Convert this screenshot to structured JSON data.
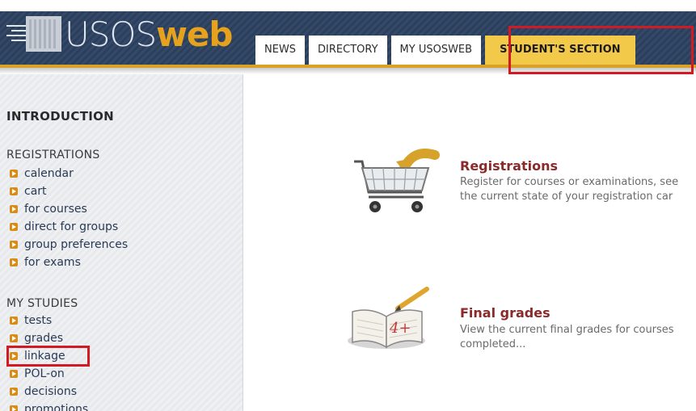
{
  "logo": {
    "part1": "USOS",
    "part2": "web"
  },
  "tabs": [
    {
      "label": "NEWS"
    },
    {
      "label": "DIRECTORY"
    },
    {
      "label": "MY USOSWEB"
    },
    {
      "label": "STUDENT'S SECTION"
    }
  ],
  "sidebar": {
    "intro": "INTRODUCTION",
    "registrations": {
      "heading": "REGISTRATIONS",
      "items": [
        {
          "label": "calendar"
        },
        {
          "label": "cart"
        },
        {
          "label": "for courses"
        },
        {
          "label": "direct for groups"
        },
        {
          "label": "group preferences"
        },
        {
          "label": "for exams"
        }
      ]
    },
    "studies": {
      "heading": "MY STUDIES",
      "items": [
        {
          "label": "tests"
        },
        {
          "label": "grades"
        },
        {
          "label": "linkage"
        },
        {
          "label": "POL-on"
        },
        {
          "label": "decisions"
        },
        {
          "label": "promotions"
        }
      ]
    }
  },
  "main": {
    "registrations": {
      "title": "Registrations",
      "desc_line1": "Register for courses or examinations, see",
      "desc_line2": "the current state of your registration car"
    },
    "grades": {
      "title": "Final grades",
      "desc_line1": "View the current final grades for courses",
      "desc_line2": "completed...",
      "icon_text": "4+"
    }
  },
  "colors": {
    "accent": "#f3c94a",
    "highlight": "#d11a23",
    "link_title": "#8b2a2a",
    "header": "#2c3f5a"
  }
}
